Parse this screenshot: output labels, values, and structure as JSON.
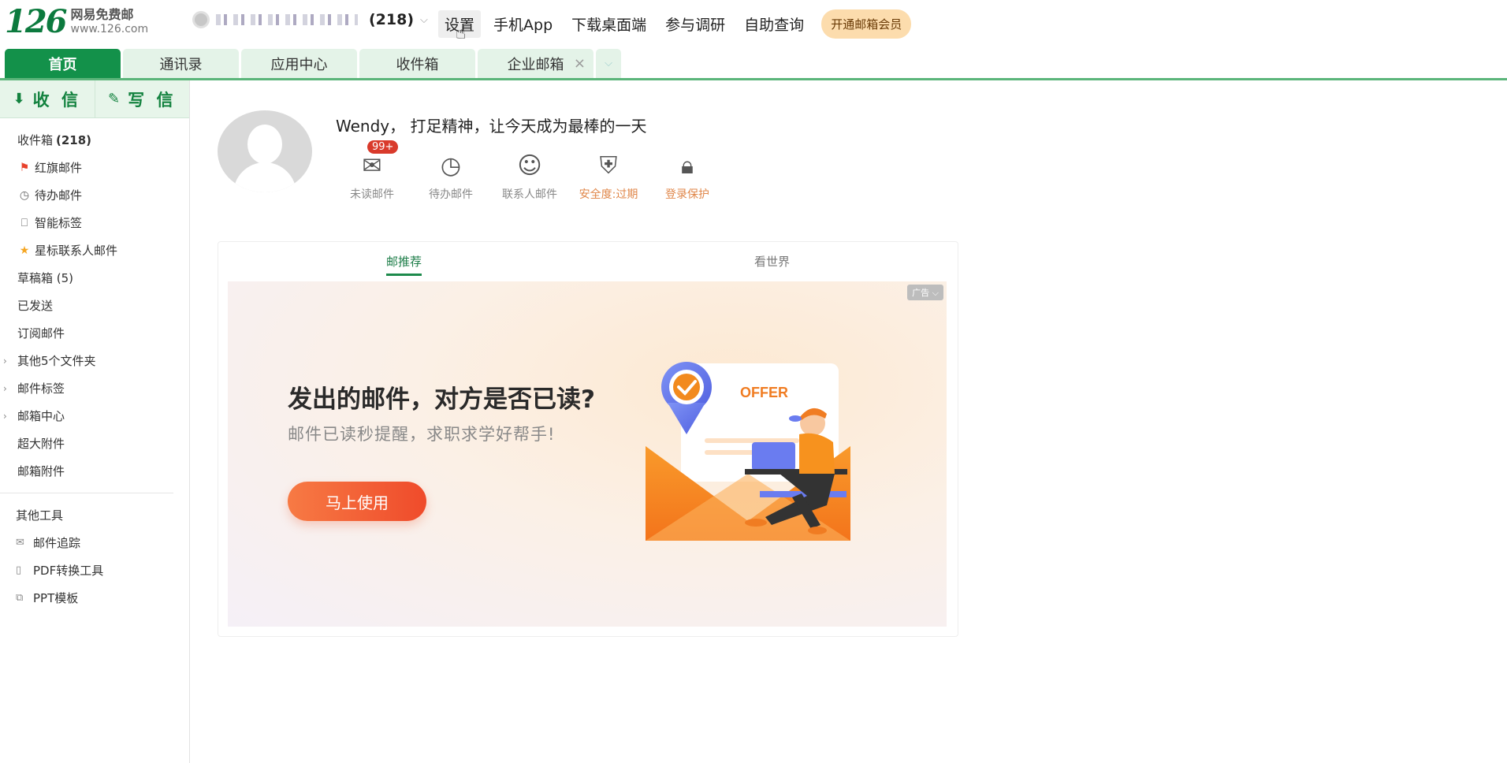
{
  "logo": {
    "mark": "126",
    "name": "网易免费邮",
    "url": "www.126.com"
  },
  "account": {
    "unread_count": "(218)"
  },
  "top_nav": {
    "settings": "设置",
    "mobile_app": "手机App",
    "desktop": "下载桌面端",
    "survey": "参与调研",
    "self_service": "自助查询",
    "vip": "开通邮箱会员"
  },
  "tabs": [
    {
      "label": "首页"
    },
    {
      "label": "通讯录"
    },
    {
      "label": "应用中心"
    },
    {
      "label": "收件箱"
    },
    {
      "label": "企业邮箱"
    }
  ],
  "sidebar": {
    "receive": "收 信",
    "compose": "写 信",
    "items": [
      {
        "label": "收件箱",
        "count": "(218)"
      },
      {
        "label": "红旗邮件"
      },
      {
        "label": "待办邮件"
      },
      {
        "label": "智能标签"
      },
      {
        "label": "星标联系人邮件"
      },
      {
        "label": "草稿箱 (5)"
      },
      {
        "label": "已发送"
      },
      {
        "label": "订阅邮件"
      },
      {
        "label": "其他5个文件夹"
      },
      {
        "label": "邮件标签"
      },
      {
        "label": "邮箱中心"
      },
      {
        "label": "超大附件"
      },
      {
        "label": "邮箱附件"
      }
    ],
    "tools_title": "其他工具",
    "tools": [
      {
        "label": "邮件追踪"
      },
      {
        "label": "PDF转换工具"
      },
      {
        "label": "PPT模板"
      }
    ]
  },
  "profile": {
    "greeting": "Wendy， 打足精神，让今天成为最棒的一天",
    "unread_badge": "99+",
    "shortcuts": [
      {
        "label": "未读邮件",
        "icon": "mail-icon"
      },
      {
        "label": "待办邮件",
        "icon": "clock-icon"
      },
      {
        "label": "联系人邮件",
        "icon": "contact-icon"
      },
      {
        "label": "安全度:过期",
        "icon": "shield-icon"
      },
      {
        "label": "登录保护",
        "icon": "lock-icon"
      }
    ]
  },
  "card": {
    "tabs": [
      "邮推荐",
      "看世界"
    ],
    "ad": {
      "tag": "广告",
      "title": "发出的邮件，对方是否已读?",
      "subtitle": "邮件已读秒提醒，求职求学好帮手!",
      "button": "马上使用",
      "offer_text": "OFFER"
    }
  },
  "colors": {
    "brand_green": "#13914a",
    "badge_red": "#d93a2b",
    "ad_button": "#ef4b2b"
  }
}
